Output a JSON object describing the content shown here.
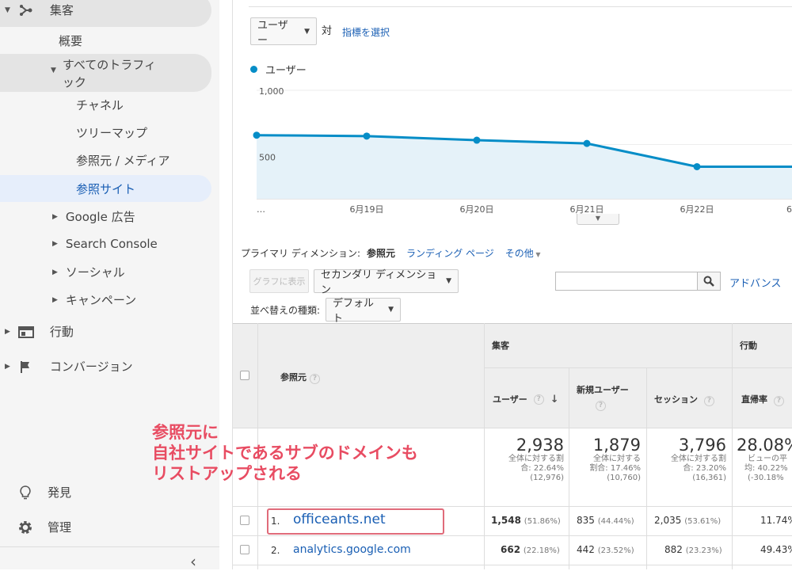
{
  "sidebar": {
    "acquisition": "集客",
    "overview": "概要",
    "all_traffic_line1": "すべてのトラフィ",
    "all_traffic_line2": "ック",
    "channels": "チャネル",
    "treemaps": "ツリーマップ",
    "source_medium": "参照元 / メディア",
    "referrals": "参照サイト",
    "google_ads": "Google 広告",
    "search_console": "Search Console",
    "social": "ソーシャル",
    "campaigns": "キャンペーン",
    "behavior": "行動",
    "conversions": "コンバージョン",
    "discover": "発見",
    "admin": "管理",
    "collapse": "‹"
  },
  "chart_controls": {
    "metric_select": "ユーザー",
    "vs": "対",
    "select_metric": "指標を選択"
  },
  "chart_data": {
    "type": "area",
    "legend": "ユーザー",
    "x": [
      "…",
      "6月19日",
      "6月20日",
      "6月21日",
      "6月22日",
      "6"
    ],
    "series": [
      {
        "name": "ユーザー",
        "values": [
          586,
          578,
          540,
          510,
          296,
          296,
          296
        ]
      }
    ],
    "y_ticks": [
      "1,000",
      "500"
    ],
    "ylim": [
      0,
      1000
    ],
    "color": "#058dc7"
  },
  "dimension": {
    "label": "プライマリ ディメンション:",
    "source": "参照元",
    "landing": "ランディング ページ",
    "other": "その他"
  },
  "toolbar": {
    "plot_rows": "グラフに表示",
    "secondary": "セカンダリ ディメンション",
    "advanced": "アドバンス",
    "sort_label": "並べ替えの種類:",
    "sort_value": "デフォルト"
  },
  "table": {
    "col_source": "参照元",
    "group_acq": "集客",
    "group_beh": "行動",
    "col_users": "ユーザー",
    "col_new_line1": "新規ユーザー",
    "col_sessions": "セッション",
    "col_bounce": "直帰率",
    "totals": {
      "users": "2,938",
      "users_sub1": "全体に対する割",
      "users_sub2": "合: 22.64%",
      "users_sub3": "(12,976)",
      "new": "1,879",
      "new_sub1": "全体に対する",
      "new_sub2": "割合: 17.46%",
      "new_sub3": "(10,760)",
      "sessions": "3,796",
      "sessions_sub1": "全体に対する割",
      "sessions_sub2": "合: 23.20%",
      "sessions_sub3": "(16,361)",
      "bounce": "28.08%",
      "bounce_sub1": "ビューの平",
      "bounce_sub2": "均: 40.22%",
      "bounce_sub3": "(-30.18%"
    },
    "rows": [
      {
        "num": "1.",
        "source": "officeants.net",
        "users": "1,548",
        "users_pct": "(51.86%)",
        "new": "835",
        "new_pct": "(44.44%)",
        "sessions": "2,035",
        "sessions_pct": "(53.61%)",
        "bounce": "11.74%"
      },
      {
        "num": "2.",
        "source": "analytics.google.com",
        "users": "662",
        "users_pct": "(22.18%)",
        "new": "442",
        "new_pct": "(23.52%)",
        "sessions": "882",
        "sessions_pct": "(23.23%)",
        "bounce": "49.43%"
      }
    ]
  },
  "annotation": {
    "line1": "参照元に",
    "line2": "自社サイトであるサブのドメインも",
    "line3": "リストアップされる"
  }
}
